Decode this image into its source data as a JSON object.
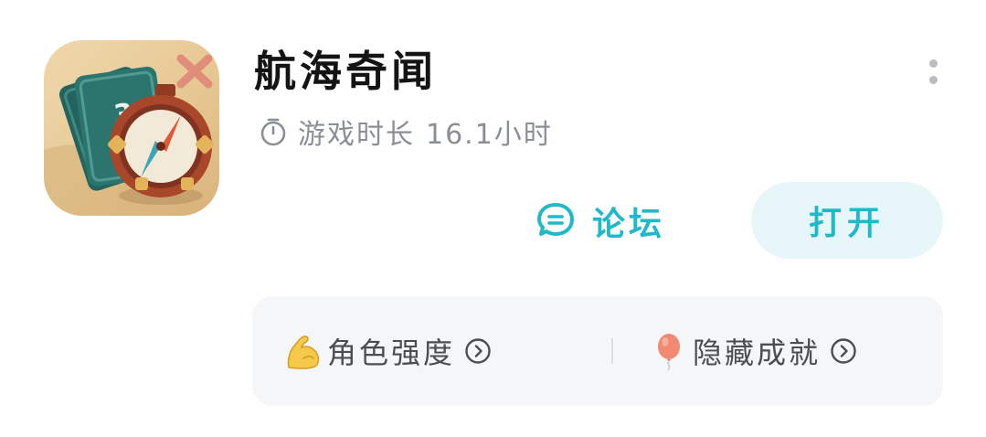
{
  "app": {
    "title": "航海奇闻",
    "icon": "compass-and-map-app-icon"
  },
  "playtime": {
    "label": "游戏时长",
    "value": "16.1小时",
    "icon": "timer-icon"
  },
  "actions": {
    "forum_label": "论坛",
    "forum_icon": "chat-bubble-icon",
    "open_label": "打开"
  },
  "card": {
    "items": [
      {
        "emoji": "flexed-biceps-icon",
        "label": "角色强度"
      },
      {
        "emoji": "balloon-icon",
        "label": "隐藏成就"
      }
    ]
  },
  "colors": {
    "accent": "#1fb9c9",
    "open_button_bg": "#e7f7f9",
    "card_bg": "#f5f6f8",
    "muted_text": "#8a8e95"
  }
}
